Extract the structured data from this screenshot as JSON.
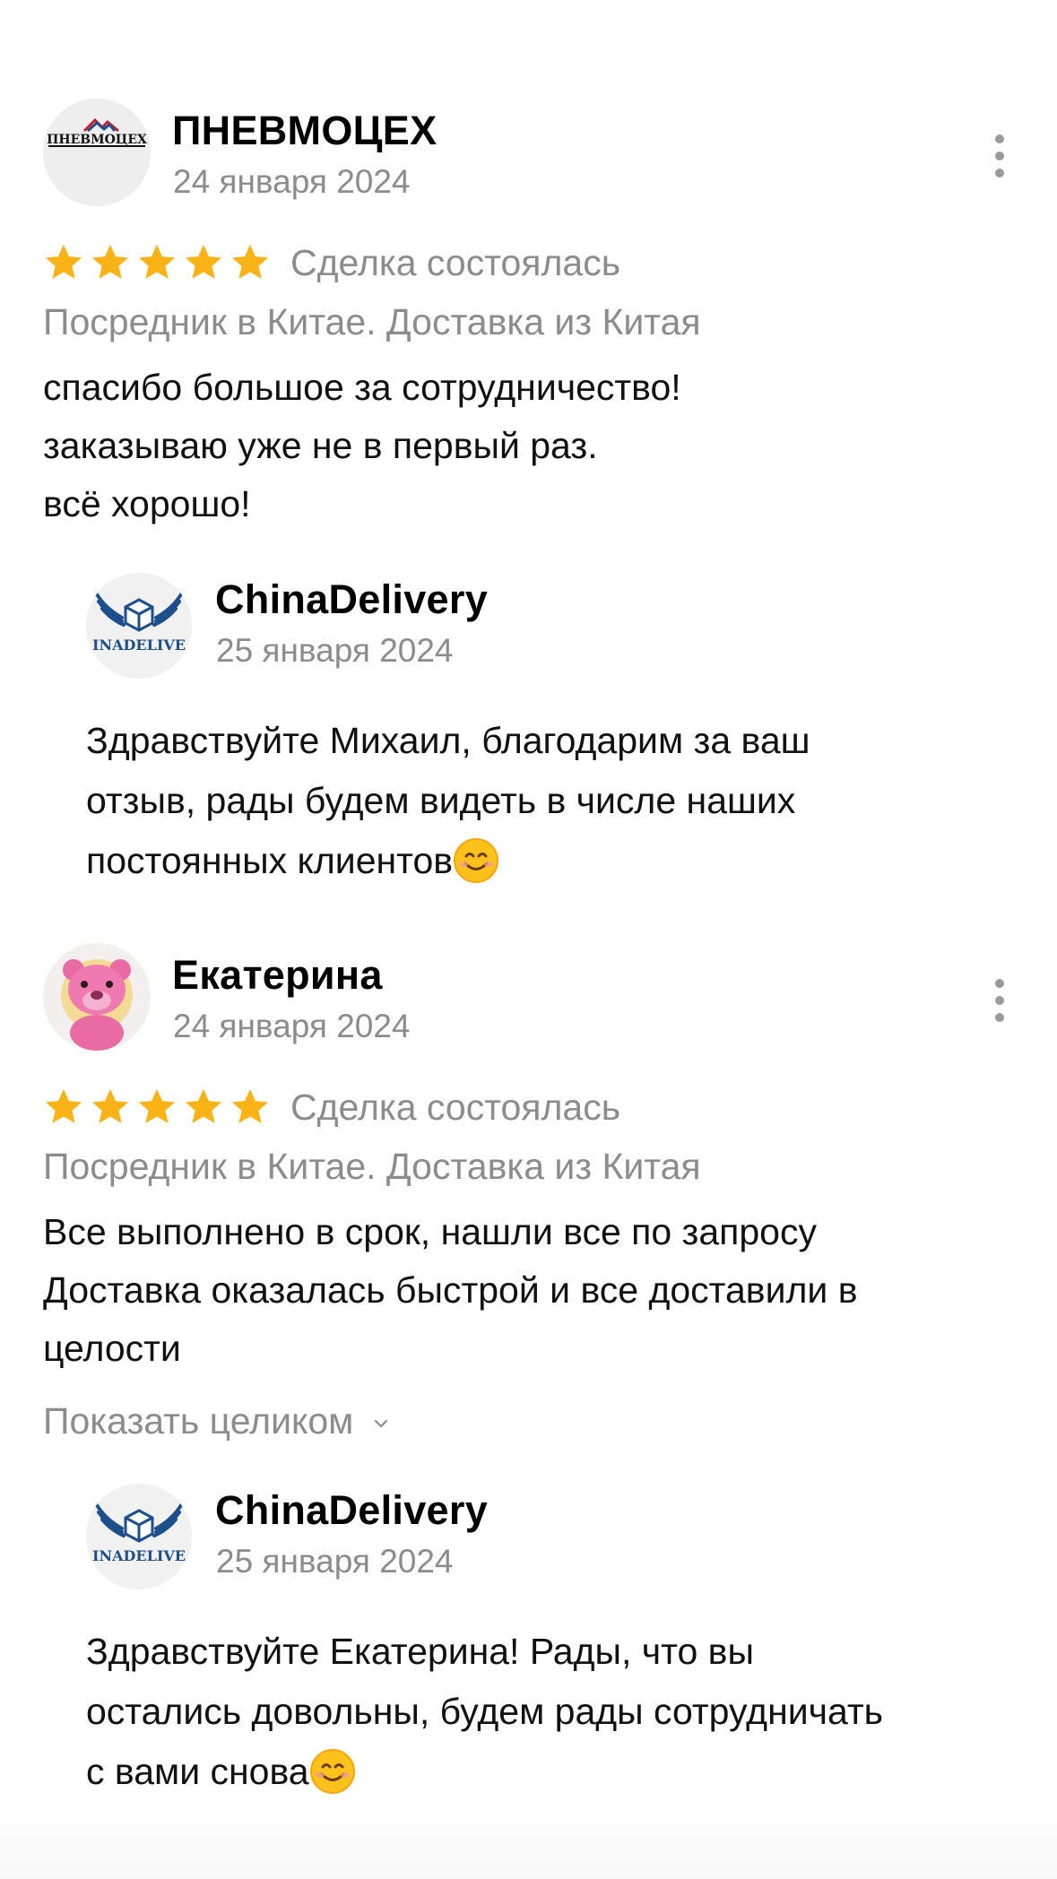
{
  "reviews": [
    {
      "author": "ПНЕВМОЦЕХ",
      "avatar_text": "ПНЕВМОЦЕХ",
      "date": "24 января 2024",
      "rating": 5,
      "deal_status": "Сделка состоялась",
      "category": "Посредник в Китае. Доставка из Китая",
      "text_lines": [
        "спасибо большое за сотрудничество!",
        "заказываю уже не в первый раз.",
        "всё хорошо!"
      ],
      "reply": {
        "author": "ChinaDelivery",
        "avatar_text": "INADELIVE",
        "date": "25 января 2024",
        "text_lines": [
          "Здравствуйте Михаил, благодарим за ваш",
          "отзыв, рады будем видеть в числе наших",
          "постоянных клиентов"
        ]
      }
    },
    {
      "author": "Екатерина",
      "date": "24 января 2024",
      "rating": 5,
      "deal_status": "Сделка состоялась",
      "category": "Посредник в Китае. Доставка из Китая",
      "text_lines": [
        "Все выполнено в срок, нашли все по запросу",
        "Доставка оказалась быстрой и все доставили в",
        "целости"
      ],
      "show_full_label": "Показать целиком",
      "reply": {
        "author": "ChinaDelivery",
        "avatar_text": "INADELIVE",
        "date": "25 января 2024",
        "text_lines": [
          "Здравствуйте Екатерина! Рады, что вы",
          "остались довольны, будем рады сотрудничать",
          "с вами снова"
        ]
      }
    }
  ],
  "colors": {
    "star": "#F9B316",
    "secondary_text": "#8C8C8C",
    "logo_blue": "#1E4E8C",
    "logo_red": "#C8202A"
  },
  "icons": {
    "more": "more-vertical-icon",
    "star": "star-icon",
    "chevron": "chevron-down-icon",
    "emoji": "smiling-face-emoji"
  }
}
